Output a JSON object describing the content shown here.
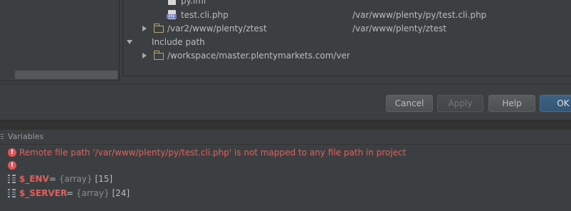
{
  "tree": {
    "partial_top_item": "py.iml",
    "rows": [
      {
        "label": "test.cli.php",
        "path": "/var/www/plenty/py/test.cli.php",
        "icon": "php-file-icon"
      },
      {
        "label": "/var2/www/plenty/ztest",
        "path": "/var/www/plenty/ztest",
        "icon": "folder-icon"
      },
      {
        "label": "Include path",
        "path": "",
        "icon": ""
      },
      {
        "label": "/workspace/master.plentymarkets.com/venc",
        "path": "",
        "icon": "folder-icon"
      }
    ]
  },
  "buttons": {
    "cancel": "Cancel",
    "apply": "Apply",
    "help": "Help",
    "ok": "OK"
  },
  "variables": {
    "title": "Variables",
    "error_message": "Remote file path '/var/www/plenty/py/test.cli.php' is not mapped to any file path in project",
    "items": [
      {
        "name": "$_ENV",
        "equals": "=",
        "type": "{array}",
        "count": "[15]"
      },
      {
        "name": "$_SERVER",
        "equals": "=",
        "type": "{array}",
        "count": "[24]"
      }
    ]
  },
  "colors": {
    "background": "#3c3f41",
    "error": "#e06060",
    "default_button": "#365880"
  }
}
